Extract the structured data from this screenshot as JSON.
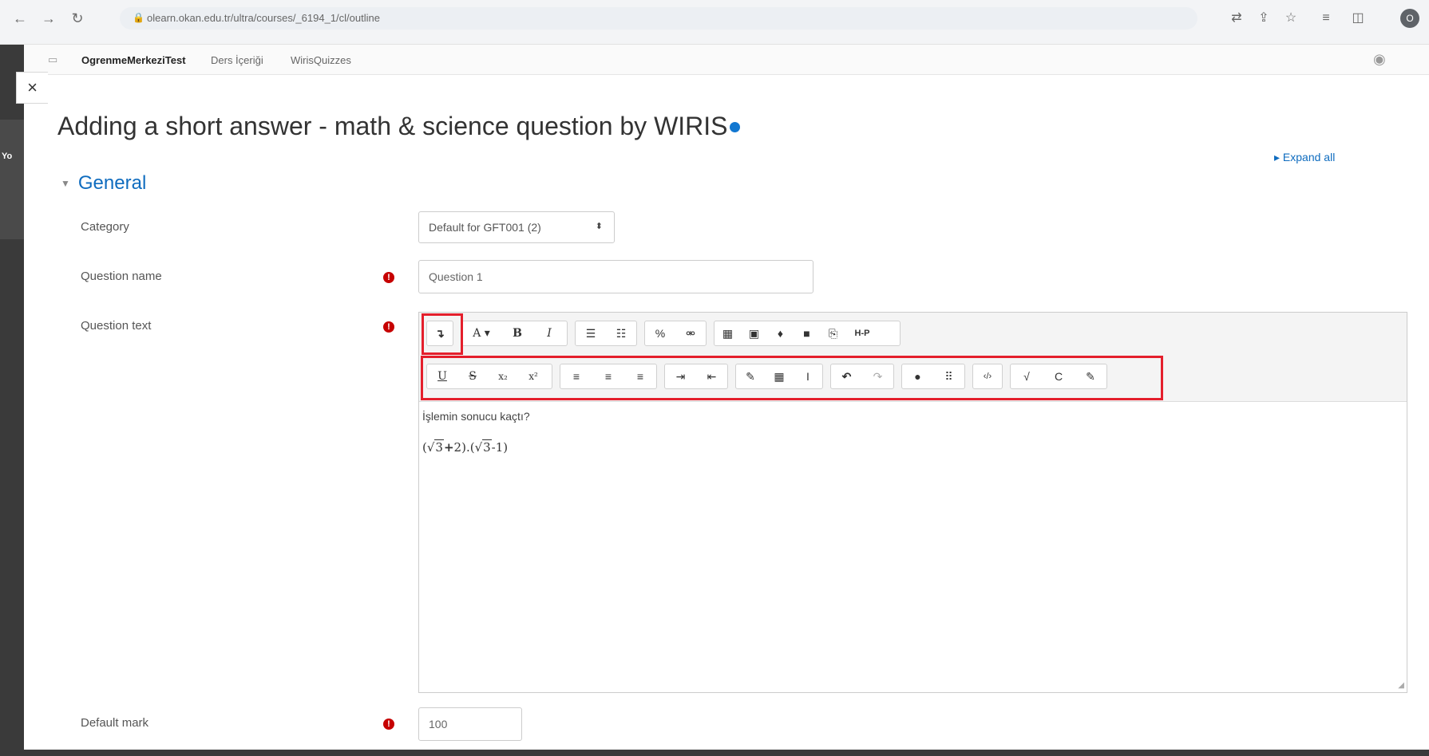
{
  "browser": {
    "url": "olearn.okan.edu.tr/ultra/courses/_6194_1/cl/outline",
    "profile_initial": "O"
  },
  "leftstrip": {
    "label": "Yo"
  },
  "topnav": {
    "course_name": "OgrenmeMerkeziTest",
    "tabs": [
      "Ders İçeriği",
      "WirisQuizzes"
    ]
  },
  "page": {
    "title": "Adding a short answer - math & science question by WIRIS",
    "expand_all": "Expand all",
    "section": "General"
  },
  "form": {
    "category_label": "Category",
    "category_value": "Default for GFT001 (2)",
    "question_name_label": "Question name",
    "question_name_value": "Question 1",
    "question_text_label": "Question text",
    "question_text_line1": "İşlemin sonucu kaçtı?",
    "math": {
      "open": "(",
      "sqrt1": "3",
      "plus": "+",
      "two": "2).(",
      "sqrt2": "3",
      "tail": "-1)"
    },
    "default_mark_label": "Default mark",
    "default_mark_value": "100"
  },
  "toolbar": {
    "row1": {
      "toggle": "↴",
      "font": "A ▾",
      "bold": "B",
      "italic": "I",
      "ul": "☰",
      "ol": "☷",
      "link": "%",
      "unlink": "⚮",
      "image": "▦",
      "media": "▣",
      "mic": "♦",
      "video": "■",
      "manage": "⎘",
      "h5p": "H-P"
    },
    "row2": {
      "underline": "U",
      "strike": "S",
      "subscript": "x₂",
      "superscript": "x²",
      "align_left": "≡",
      "align_center": "≡",
      "align_right": "≡",
      "indent": "⇥",
      "outdent": "⇤",
      "equation": "✎",
      "table": "▦",
      "clear": "I",
      "undo": "↶",
      "redo": "↷",
      "accessibility": "●",
      "screenreader": "⠿",
      "html": "‹/›",
      "wiris_math": "√",
      "wiris_chem": "C",
      "wiris_hand": "✎"
    }
  }
}
